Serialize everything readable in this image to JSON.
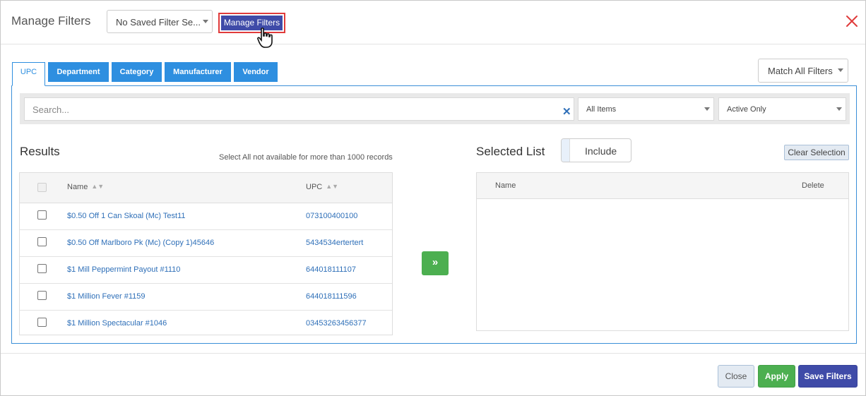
{
  "header": {
    "title": "Manage Filters",
    "saved_filter_value": "No Saved Filter Se...",
    "manage_filters_label": "Manage Filters"
  },
  "tabs": [
    {
      "label": "UPC",
      "active": true
    },
    {
      "label": "Department",
      "active": false
    },
    {
      "label": "Category",
      "active": false
    },
    {
      "label": "Manufacturer",
      "active": false
    },
    {
      "label": "Vendor",
      "active": false
    }
  ],
  "match_select": "Match All Filters",
  "search": {
    "placeholder": "Search...",
    "items_select": "All Items",
    "status_select": "Active Only"
  },
  "results": {
    "title": "Results",
    "note": "Select All not available for more than 1000 records",
    "columns": {
      "name": "Name",
      "upc": "UPC"
    },
    "rows": [
      {
        "name": "$0.50 Off 1 Can Skoal (Mc) Test11",
        "upc": "073100400100"
      },
      {
        "name": "$0.50 Off Marlboro Pk (Mc) (Copy 1)45646",
        "upc": "5434534ertertert"
      },
      {
        "name": "$1 Mill Peppermint Payout #1110",
        "upc": "644018111107"
      },
      {
        "name": "$1 Million Fever #1159",
        "upc": "644018111596"
      },
      {
        "name": "$1 Million Spectacular #1046",
        "upc": "03453263456377"
      }
    ]
  },
  "move_button_icon": "double-chevron-right-icon",
  "selected": {
    "title": "Selected List",
    "toggle_label": "Include",
    "clear_label": "Clear Selection",
    "columns": {
      "name": "Name",
      "delete": "Delete"
    }
  },
  "footer": {
    "close_label": "Close",
    "apply_label": "Apply",
    "save_label": "Save Filters"
  },
  "colors": {
    "primary": "#3f4ba8",
    "tab_blue": "#2e8fe0",
    "success": "#4caf50",
    "danger": "#e03b3b",
    "link": "#2e6fb8"
  }
}
